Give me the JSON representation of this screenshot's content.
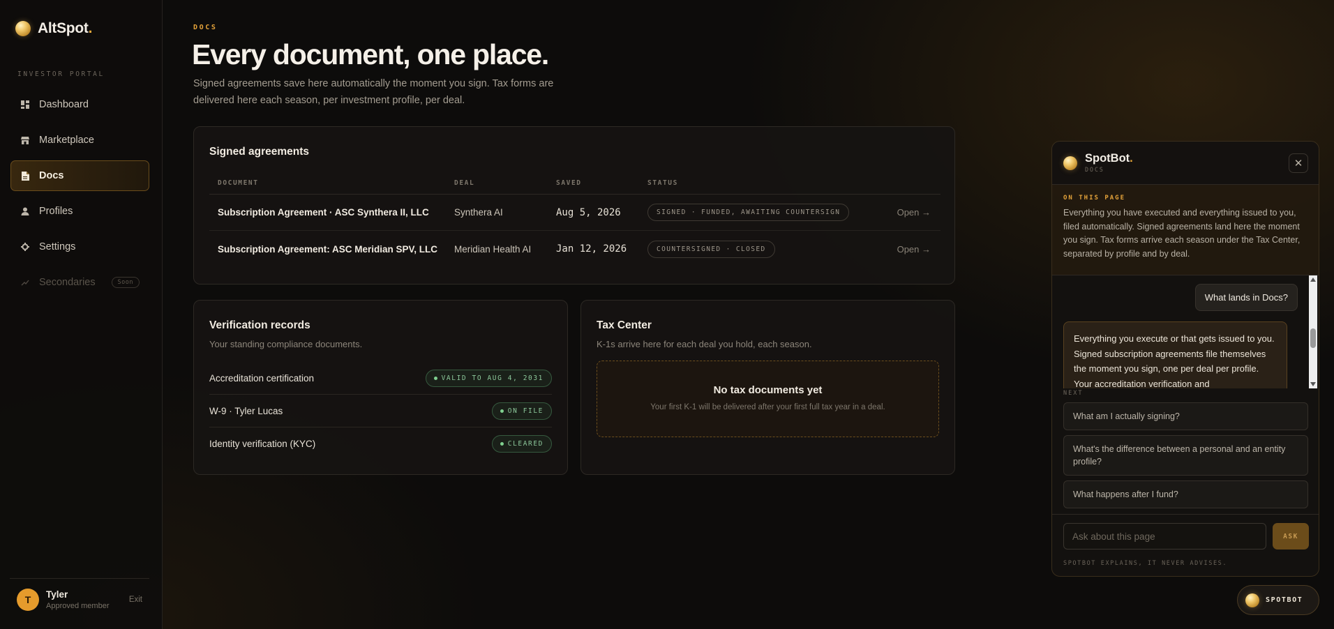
{
  "brand": {
    "name": "AltSpot",
    "dot": "."
  },
  "sidebar": {
    "section_label": "INVESTOR PORTAL",
    "items": [
      {
        "label": "Dashboard",
        "icon": "grid-icon"
      },
      {
        "label": "Marketplace",
        "icon": "store-icon"
      },
      {
        "label": "Docs",
        "icon": "document-icon",
        "active": true
      },
      {
        "label": "Profiles",
        "icon": "person-icon"
      },
      {
        "label": "Settings",
        "icon": "gear-icon"
      },
      {
        "label": "Secondaries",
        "icon": "trend-icon",
        "badge": "Soon",
        "disabled": true
      }
    ],
    "user": {
      "initial": "T",
      "name": "Tyler",
      "role": "Approved member",
      "exit_label": "Exit"
    }
  },
  "main": {
    "eyebrow": "DOCS",
    "title": "Every document, one place.",
    "subtitle": "Signed agreements save here automatically the moment you sign. Tax forms are delivered here each season, per investment profile, per deal.",
    "agreements": {
      "title": "Signed agreements",
      "columns": [
        "DOCUMENT",
        "DEAL",
        "SAVED",
        "STATUS"
      ],
      "rows": [
        {
          "document": "Subscription Agreement · ASC Synthera II, LLC",
          "deal": "Synthera AI",
          "saved": "Aug 5, 2026",
          "status": "SIGNED · FUNDED, AWAITING COUNTERSIGN",
          "action": "Open →"
        },
        {
          "document": "Subscription Agreement: ASC Meridian SPV, LLC",
          "deal": "Meridian Health AI",
          "saved": "Jan 12, 2026",
          "status": "COUNTERSIGNED · CLOSED",
          "action": "Open →"
        }
      ]
    },
    "verification": {
      "title": "Verification records",
      "subtitle": "Your standing compliance documents.",
      "rows": [
        {
          "label": "Accreditation certification",
          "status": "VALID TO AUG 4, 2031"
        },
        {
          "label": "W-9 · Tyler Lucas",
          "status": "ON FILE"
        },
        {
          "label": "Identity verification (KYC)",
          "status": "CLEARED"
        }
      ]
    },
    "tax": {
      "title": "Tax Center",
      "subtitle": "K-1s arrive here for each deal you hold, each season.",
      "empty_title": "No tax documents yet",
      "empty_sub": "Your first K-1 will be delivered after your first full tax year in a deal."
    }
  },
  "spotbot": {
    "name": "SpotBot",
    "dot": ".",
    "context": "DOCS",
    "on_this_page_label": "ON THIS PAGE",
    "on_this_page_text": "Everything you have executed and everything issued to you, filed automatically. Signed agreements land here the moment you sign. Tax forms arrive each season under the Tax Center, separated by profile and by deal.",
    "user_message": "What lands in Docs?",
    "bot_message": "Everything you execute or that gets issued to you. Signed subscription agreements file themselves the moment you sign, one per deal per profile. Your accreditation verification and",
    "next_label": "NEXT",
    "suggestions": [
      "What am I actually signing?",
      "What's the difference between a personal and an entity profile?",
      "What happens after I fund?"
    ],
    "input_placeholder": "Ask about this page",
    "ask_label": "ASK",
    "disclaimer": "SPOTBOT EXPLAINS, IT NEVER ADVISES.",
    "toggle_label": "SPOTBOT"
  },
  "colors": {
    "accent": "#e5a33a",
    "success": "#8cc79a",
    "background": "#0d0c0b"
  }
}
